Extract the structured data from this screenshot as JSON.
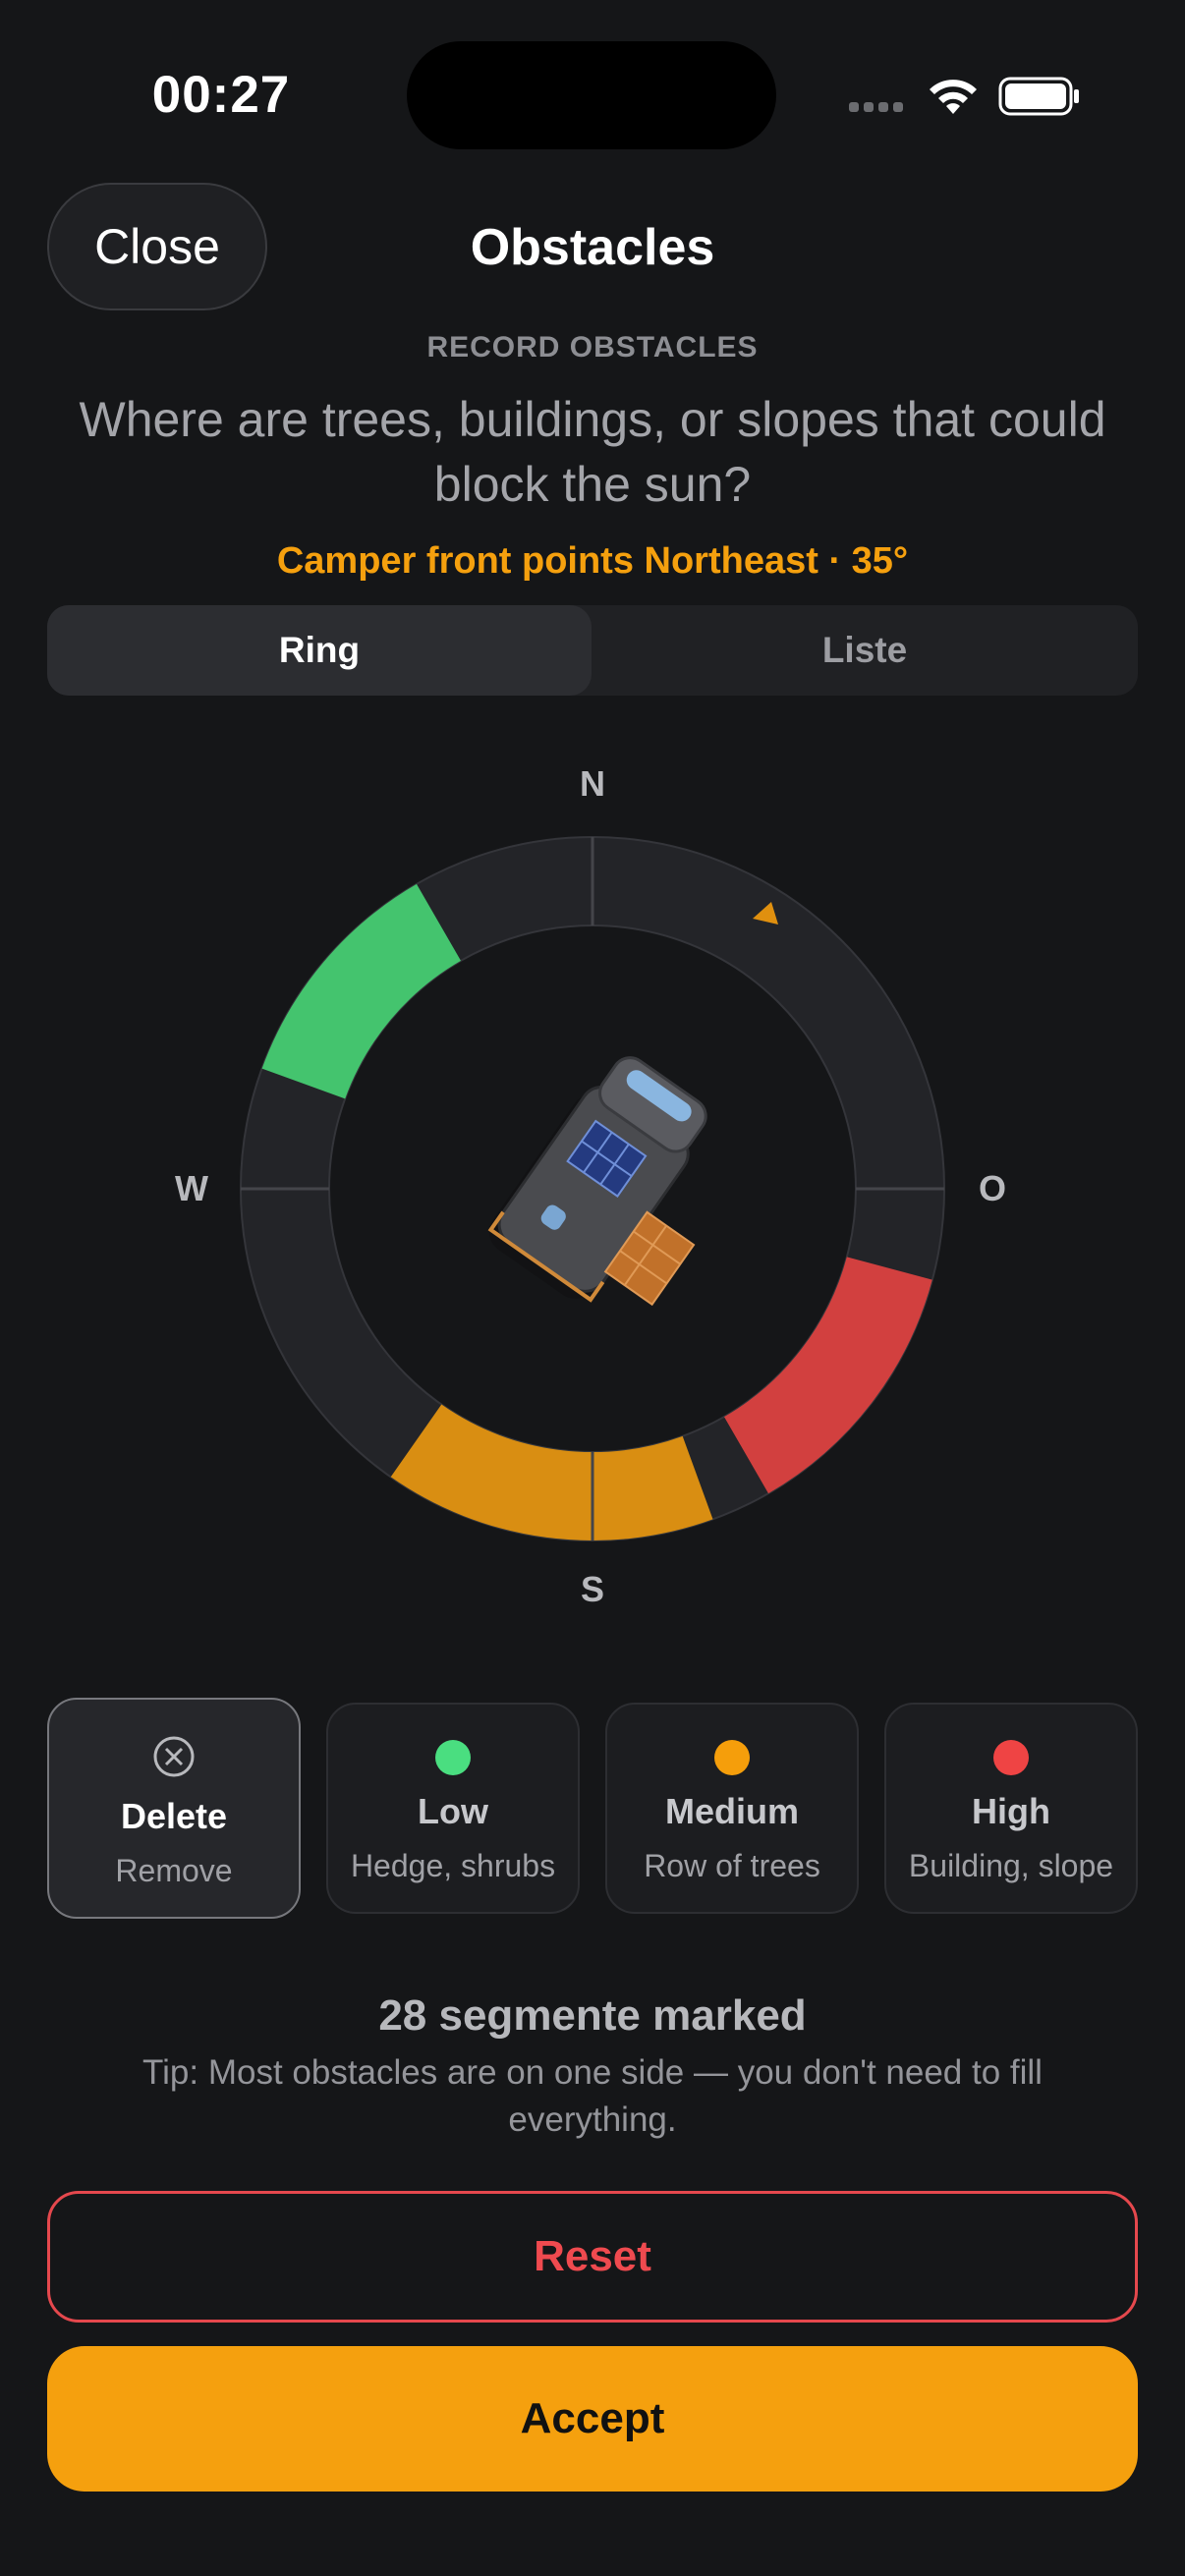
{
  "status_bar": {
    "time": "00:27"
  },
  "header": {
    "close_label": "Close",
    "title": "Obstacles"
  },
  "intro": {
    "eyebrow": "RECORD OBSTACLES",
    "question": "Where are trees, buildings, or slopes that could block the sun?",
    "orientation": "Camper front points Northeast · 35°"
  },
  "view_toggle": {
    "tabs": [
      {
        "label": "Ring",
        "selected": true
      },
      {
        "label": "Liste",
        "selected": false
      }
    ]
  },
  "compass": {
    "labels": {
      "north": "N",
      "east": "O",
      "south": "S",
      "west": "W"
    },
    "heading_degrees": 35,
    "obstacle_arcs": [
      {
        "level": "low",
        "from_degrees": 290,
        "to_degrees": 330
      },
      {
        "level": "high",
        "from_degrees": 105,
        "to_degrees": 150
      },
      {
        "level": "medium",
        "from_degrees": 160,
        "to_degrees": 215
      }
    ],
    "camper_icon": "camper-van-icon"
  },
  "levels": [
    {
      "title": "Delete",
      "subtitle": "Remove",
      "icon": "delete-circle-icon",
      "selected": true
    },
    {
      "title": "Low",
      "subtitle": "Hedge, shrubs",
      "color": "#4ade80",
      "selected": false
    },
    {
      "title": "Medium",
      "subtitle": "Row of trees",
      "color": "#f59e0b",
      "selected": false
    },
    {
      "title": "High",
      "subtitle": "Building, slope",
      "color": "#ef4444",
      "selected": false
    }
  ],
  "summary": {
    "count_text": "28 segmente marked",
    "tip": "Tip: Most obstacles are on one side — you don't need to fill everything."
  },
  "actions": {
    "reset_label": "Reset",
    "accept_label": "Accept"
  },
  "colors": {
    "accent": "#f5a00e",
    "low": "#44c46e",
    "medium": "#d98e12",
    "high": "#d2403f",
    "background": "#151618"
  }
}
